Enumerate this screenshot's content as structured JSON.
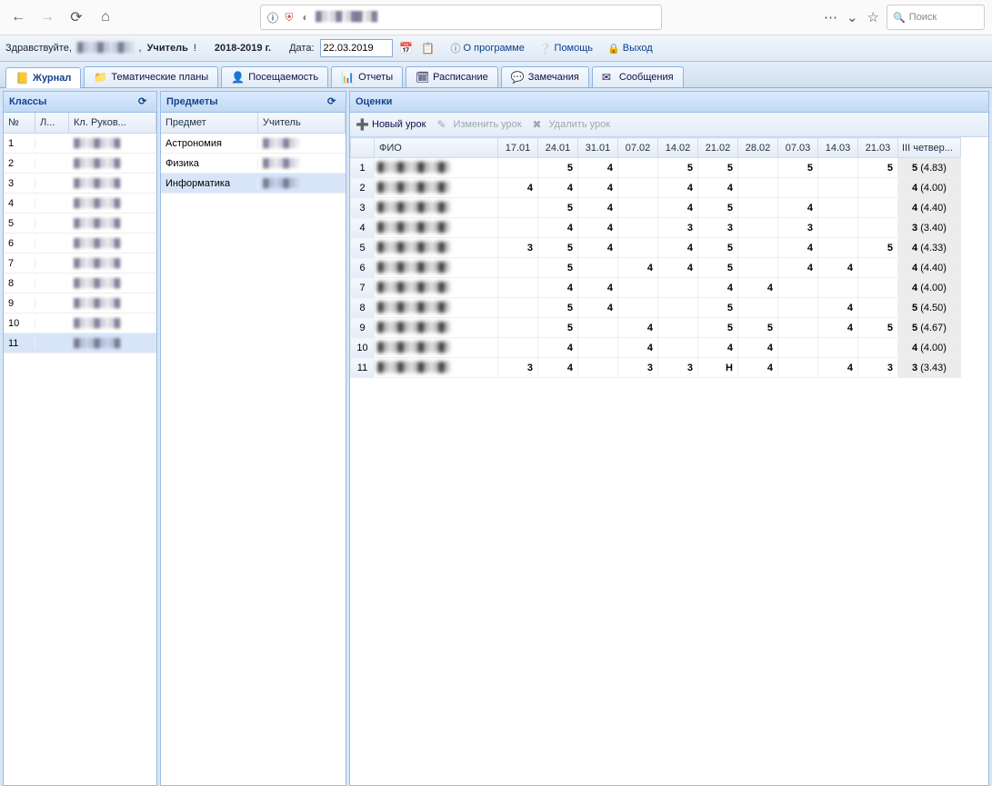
{
  "browser": {
    "search_placeholder": "Поиск"
  },
  "header": {
    "greeting": "Здравствуйте,",
    "role": "Учитель",
    "year": "2018-2019 г.",
    "date_label": "Дата:",
    "date_value": "22.03.2019",
    "about": "О программе",
    "help": "Помощь",
    "exit": "Выход"
  },
  "tabs": [
    {
      "label": "Журнал",
      "active": true,
      "icon": "📒"
    },
    {
      "label": "Тематические планы",
      "active": false,
      "icon": "📁"
    },
    {
      "label": "Посещаемость",
      "active": false,
      "icon": "👤"
    },
    {
      "label": "Отчеты",
      "active": false,
      "icon": "📊"
    },
    {
      "label": "Расписание",
      "active": false,
      "icon": "🗓"
    },
    {
      "label": "Замечания",
      "active": false,
      "icon": "💬"
    },
    {
      "label": "Сообщения",
      "active": false,
      "icon": "✉"
    }
  ],
  "classes": {
    "title": "Классы",
    "headers": {
      "num": "№",
      "lit": "Л...",
      "ruk": "Кл. Руков..."
    },
    "rows": [
      {
        "num": "1",
        "sel": false
      },
      {
        "num": "2",
        "sel": false
      },
      {
        "num": "3",
        "sel": false
      },
      {
        "num": "4",
        "sel": false
      },
      {
        "num": "5",
        "sel": false
      },
      {
        "num": "6",
        "sel": false
      },
      {
        "num": "7",
        "sel": false
      },
      {
        "num": "8",
        "sel": false
      },
      {
        "num": "9",
        "sel": false
      },
      {
        "num": "10",
        "sel": false
      },
      {
        "num": "11",
        "sel": true
      }
    ]
  },
  "subjects": {
    "title": "Предметы",
    "headers": {
      "subj": "Предмет",
      "teacher": "Учитель"
    },
    "rows": [
      {
        "name": "Астрономия",
        "sel": false
      },
      {
        "name": "Физика",
        "sel": false
      },
      {
        "name": "Информатика",
        "sel": true
      }
    ]
  },
  "grades": {
    "title": "Оценки",
    "toolbar": {
      "new": "Новый урок",
      "edit": "Изменить урок",
      "del": "Удалить урок"
    },
    "headers": {
      "fio": "ФИО",
      "quarter": "III четвер...",
      "dates": [
        "17.01",
        "24.01",
        "31.01",
        "07.02",
        "14.02",
        "21.02",
        "28.02",
        "07.03",
        "14.03",
        "21.03"
      ]
    },
    "rows": [
      {
        "n": "1",
        "d": [
          "",
          "5",
          "4",
          "",
          "5",
          "5",
          "",
          "5",
          "",
          "5"
        ],
        "q": "5",
        "avg": "(4.83)"
      },
      {
        "n": "2",
        "d": [
          "4",
          "4",
          "4",
          "",
          "4",
          "4",
          "",
          "",
          "",
          ""
        ],
        "q": "4",
        "avg": "(4.00)"
      },
      {
        "n": "3",
        "d": [
          "",
          "5",
          "4",
          "",
          "4",
          "5",
          "",
          "4",
          "",
          ""
        ],
        "q": "4",
        "avg": "(4.40)"
      },
      {
        "n": "4",
        "d": [
          "",
          "4",
          "4",
          "",
          "3",
          "3",
          "",
          "3",
          "",
          ""
        ],
        "q": "3",
        "avg": "(3.40)"
      },
      {
        "n": "5",
        "d": [
          "3",
          "5",
          "4",
          "",
          "4",
          "5",
          "",
          "4",
          "",
          "5"
        ],
        "q": "4",
        "avg": "(4.33)"
      },
      {
        "n": "6",
        "d": [
          "",
          "5",
          "",
          "4",
          "4",
          "5",
          "",
          "4",
          "4",
          ""
        ],
        "q": "4",
        "avg": "(4.40)"
      },
      {
        "n": "7",
        "d": [
          "",
          "4",
          "4",
          "",
          "",
          "4",
          "4",
          "",
          "",
          ""
        ],
        "q": "4",
        "avg": "(4.00)"
      },
      {
        "n": "8",
        "d": [
          "",
          "5",
          "4",
          "",
          "",
          "5",
          "",
          "",
          "4",
          ""
        ],
        "q": "5",
        "avg": "(4.50)"
      },
      {
        "n": "9",
        "d": [
          "",
          "5",
          "",
          "4",
          "",
          "5",
          "5",
          "",
          "4",
          "5"
        ],
        "q": "5",
        "avg": "(4.67)"
      },
      {
        "n": "10",
        "d": [
          "",
          "4",
          "",
          "4",
          "",
          "4",
          "4",
          "",
          "",
          ""
        ],
        "q": "4",
        "avg": "(4.00)"
      },
      {
        "n": "11",
        "d": [
          "3",
          "4",
          "",
          "3",
          "3",
          "Н",
          "4",
          "",
          "4",
          "3"
        ],
        "q": "3",
        "avg": "(3.43)"
      }
    ]
  }
}
